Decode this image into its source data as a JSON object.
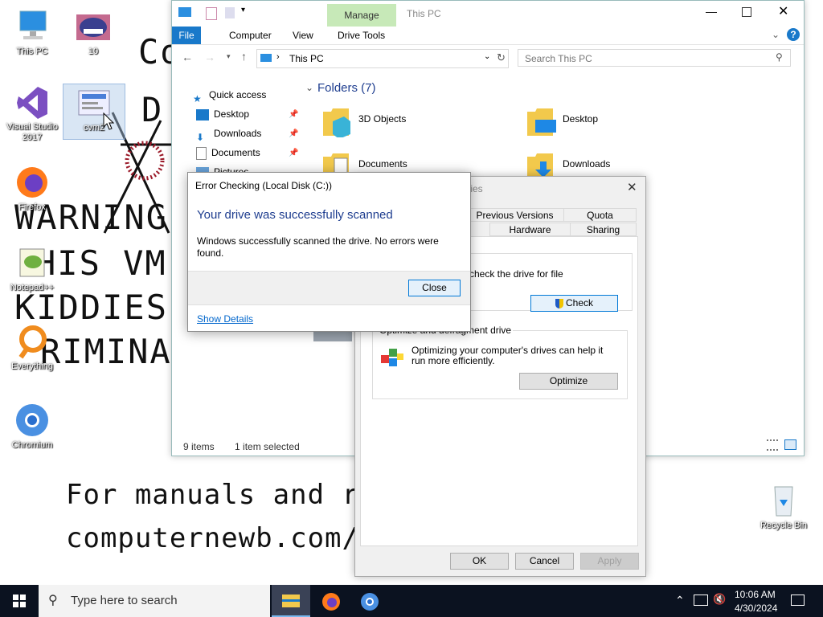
{
  "wallpaper": {
    "lines": [
      "Co",
      "D",
      "WARNING",
      "HIS VM I",
      "KIDDIES,",
      "RIMINAL",
      "For  manuals and re",
      "computernewb.com/"
    ]
  },
  "desktop_icons": [
    {
      "label": "This PC",
      "icon": "computer-icon"
    },
    {
      "label": "10",
      "icon": "avatar-image-icon"
    },
    {
      "label": "Visual Studio 2017",
      "icon": "visual-studio-icon"
    },
    {
      "label": "cvm2",
      "icon": "image-file-icon"
    },
    {
      "label": "Firefox",
      "icon": "firefox-icon"
    },
    {
      "label": "Notepad++",
      "icon": "notepadpp-icon"
    },
    {
      "label": "Everything",
      "icon": "everything-icon"
    },
    {
      "label": "Chromium",
      "icon": "chromium-icon"
    },
    {
      "label": "Recycle Bin",
      "icon": "recycle-bin-icon"
    }
  ],
  "explorer": {
    "title": "This PC",
    "manage_tab": "Manage",
    "tabs": [
      "File",
      "Computer",
      "View",
      "Drive Tools"
    ],
    "address": "This PC",
    "search_placeholder": "Search This PC",
    "nav": {
      "quick_access": "Quick access",
      "items": [
        "Desktop",
        "Downloads",
        "Documents",
        "Pictures"
      ]
    },
    "folders_header": "Folders (7)",
    "folders": [
      "3D Objects",
      "Desktop",
      "Documents",
      "Downloads"
    ],
    "status_items": "9 items",
    "status_selected": "1 item selected"
  },
  "properties": {
    "title_fragment": "ties",
    "tabs_row1": [
      "Previous Versions",
      "Quota"
    ],
    "tabs_row2": [
      "Hardware",
      "Sharing"
    ],
    "check_text": "check the drive for file",
    "check_button": "Check",
    "optimize_group": "Optimize and defragment drive",
    "optimize_text": "Optimizing your computer's drives can help it run more efficiently.",
    "optimize_button": "Optimize",
    "ok": "OK",
    "cancel": "Cancel",
    "apply": "Apply"
  },
  "error_dialog": {
    "title": "Error Checking (Local Disk (C:))",
    "heading": "Your drive was successfully scanned",
    "message": "Windows successfully scanned the drive. No errors were found.",
    "close_button": "Close",
    "show_details": "Show Details"
  },
  "taskbar": {
    "search_placeholder": "Type here to search",
    "time": "10:06 AM",
    "date": "4/30/2024"
  },
  "colors": {
    "accent": "#1979ca",
    "heading_blue": "#1e3d8f",
    "manage_green": "#c7e9b8",
    "taskbar": "#0b1220"
  }
}
